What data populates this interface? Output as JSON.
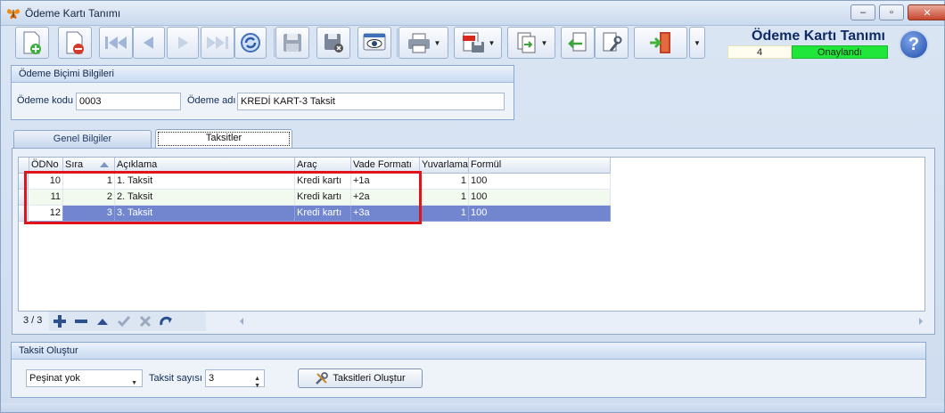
{
  "window": {
    "title": "Ödeme Kartı Tanımı",
    "controls": {
      "minimize": "–",
      "maximize": "▫",
      "close": "✕"
    }
  },
  "toolbar": {
    "buttons": [
      {
        "name": "new-record",
        "icon": "doc-add-icon"
      },
      {
        "name": "delete-record",
        "icon": "doc-remove-icon"
      },
      {
        "name": "first-record",
        "icon": "first-icon"
      },
      {
        "name": "prev-record",
        "icon": "prev-icon"
      },
      {
        "name": "next-record",
        "icon": "next-icon"
      },
      {
        "name": "last-record",
        "icon": "last-icon"
      },
      {
        "name": "refresh",
        "icon": "refresh-icon"
      },
      {
        "name": "save",
        "icon": "save-icon"
      },
      {
        "name": "cancel-save",
        "icon": "save-cancel-icon"
      },
      {
        "name": "preview",
        "icon": "preview-icon"
      },
      {
        "name": "print",
        "icon": "printer-icon"
      },
      {
        "name": "export-pdf",
        "icon": "pdf-icon"
      },
      {
        "name": "copy-doc",
        "icon": "copy-doc-icon"
      },
      {
        "name": "import-doc",
        "icon": "import-icon"
      },
      {
        "name": "settings",
        "icon": "wrench-icon"
      },
      {
        "name": "exit",
        "icon": "exit-door-icon"
      }
    ]
  },
  "header": {
    "title": "Ödeme Kartı Tanımı",
    "record_count": "4",
    "status": "Onaylandı",
    "status_color": "#20e53a",
    "help": "?"
  },
  "payment_info": {
    "group_title": "Ödeme Biçimi Bilgileri",
    "code_label": "Ödeme kodu",
    "code_value": "0003",
    "name_label": "Ödeme adı",
    "name_value": "KREDİ KART-3 Taksit"
  },
  "tabs": [
    {
      "label": "Genel Bilgiler",
      "active": false
    },
    {
      "label": "Taksitler",
      "active": true
    }
  ],
  "grid": {
    "columns": [
      "ÖDNo",
      "Sıra",
      "Açıklama",
      "Araç",
      "Vade Formatı",
      "Yuvarlama",
      "Formül"
    ],
    "rows": [
      {
        "odno": "10",
        "sira": "1",
        "aciklama": "1. Taksit",
        "arac": "Kredi kartı",
        "vade": "+1a",
        "yuvarlama": "1",
        "formul": "100"
      },
      {
        "odno": "11",
        "sira": "2",
        "aciklama": "2. Taksit",
        "arac": "Kredi kartı",
        "vade": "+2a",
        "yuvarlama": "1",
        "formul": "100"
      },
      {
        "odno": "12",
        "sira": "3",
        "aciklama": "3. Taksit",
        "arac": "Kredi kartı",
        "vade": "+3a",
        "yuvarlama": "1",
        "formul": "100"
      }
    ],
    "selected_row": 2,
    "highlight_color": "#e1141b"
  },
  "navigator": {
    "count": "3 / 3",
    "icons": [
      "add-icon",
      "remove-icon",
      "up-icon",
      "check-icon",
      "cancel-icon",
      "redo-icon"
    ]
  },
  "installment": {
    "group_title": "Taksit Oluştur",
    "down_payment_value": "Peşinat yok",
    "count_label": "Taksit sayısı",
    "count_value": "3",
    "create_button": "Taksitleri Oluştur"
  }
}
